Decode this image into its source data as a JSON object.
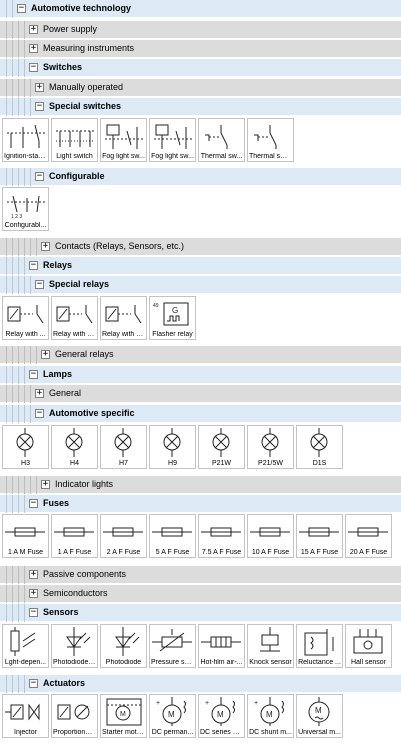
{
  "tree": {
    "automotive": {
      "label": "Automotive technology",
      "toggle": "−"
    },
    "power_supply": {
      "label": "Power supply",
      "toggle": "+"
    },
    "measuring": {
      "label": "Measuring instruments",
      "toggle": "+"
    },
    "switches": {
      "label": "Switches",
      "toggle": "−"
    },
    "manually_operated": {
      "label": "Manually operated",
      "toggle": "+"
    },
    "special_switches": {
      "label": "Special switches",
      "toggle": "−"
    },
    "configurable": {
      "label": "Configurable",
      "toggle": "−"
    },
    "contacts": {
      "label": "Contacts (Relays, Sensors, etc.)",
      "toggle": "+"
    },
    "relays": {
      "label": "Relays",
      "toggle": "−"
    },
    "special_relays": {
      "label": "Special relays",
      "toggle": "−"
    },
    "general_relays": {
      "label": "General relays",
      "toggle": "+"
    },
    "lamps": {
      "label": "Lamps",
      "toggle": "−"
    },
    "general": {
      "label": "General",
      "toggle": "+"
    },
    "automotive_specific": {
      "label": "Automotive specific",
      "toggle": "−"
    },
    "indicator_lights": {
      "label": "Indicator lights",
      "toggle": "+"
    },
    "fuses": {
      "label": "Fuses",
      "toggle": "−"
    },
    "passive": {
      "label": "Passive components",
      "toggle": "+"
    },
    "semiconductors": {
      "label": "Semiconductors",
      "toggle": "+"
    },
    "sensors": {
      "label": "Sensors",
      "toggle": "−"
    },
    "actuators": {
      "label": "Actuators",
      "toggle": "−"
    }
  },
  "tiles": {
    "special_switches": [
      {
        "caption": "Ignition-start...",
        "icon": "ignition-switch-icon"
      },
      {
        "caption": "Light switch",
        "icon": "light-switch-icon"
      },
      {
        "caption": "Fog light sw...",
        "icon": "fog-light-switch-icon"
      },
      {
        "caption": "Fog light sw...",
        "icon": "fog-light-switch-icon"
      },
      {
        "caption": "Thermal sw...",
        "icon": "thermal-switch-icon"
      },
      {
        "caption": "Thermal swi...",
        "icon": "thermal-switch-icon"
      }
    ],
    "configurable": [
      {
        "caption": "Configurabl...",
        "icon": "configurable-switch-icon"
      }
    ],
    "special_relays": [
      {
        "caption": "Relay with ...",
        "icon": "relay-icon"
      },
      {
        "caption": "Relay with b...",
        "icon": "relay-icon"
      },
      {
        "caption": "Relay with c...",
        "icon": "relay-icon"
      },
      {
        "caption": "Flasher relay",
        "icon": "flasher-relay-icon"
      }
    ],
    "automotive_specific": [
      {
        "caption": "H3",
        "icon": "lamp-icon"
      },
      {
        "caption": "H4",
        "icon": "lamp-icon"
      },
      {
        "caption": "H7",
        "icon": "lamp-icon"
      },
      {
        "caption": "H9",
        "icon": "lamp-icon"
      },
      {
        "caption": "P21W",
        "icon": "lamp-icon"
      },
      {
        "caption": "P21/5W",
        "icon": "lamp-icon"
      },
      {
        "caption": "D1S",
        "icon": "lamp-icon"
      }
    ],
    "fuses": [
      {
        "caption": "1 A M Fuse",
        "icon": "fuse-icon"
      },
      {
        "caption": "1 A F Fuse",
        "icon": "fuse-icon"
      },
      {
        "caption": "2 A F Fuse",
        "icon": "fuse-icon"
      },
      {
        "caption": "5 A F Fuse",
        "icon": "fuse-icon"
      },
      {
        "caption": "7.5 A F Fuse",
        "icon": "fuse-icon"
      },
      {
        "caption": "10 A F Fuse",
        "icon": "fuse-icon"
      },
      {
        "caption": "15 A F Fuse",
        "icon": "fuse-icon"
      },
      {
        "caption": "20 A F Fuse",
        "icon": "fuse-icon"
      }
    ],
    "sensors": [
      {
        "caption": "Lght-depen...",
        "icon": "light-dependent-resistor-icon"
      },
      {
        "caption": "Photodiode ...",
        "icon": "photodiode-icon"
      },
      {
        "caption": "Photodiode",
        "icon": "photodiode-icon"
      },
      {
        "caption": "Pressure se...",
        "icon": "pressure-sensor-icon"
      },
      {
        "caption": "Hot-film air-...",
        "icon": "hot-film-sensor-icon"
      },
      {
        "caption": "Knock sensor",
        "icon": "knock-sensor-icon"
      },
      {
        "caption": "Reluctance ...",
        "icon": "reluctance-sensor-icon"
      },
      {
        "caption": "Hall sensor",
        "icon": "hall-sensor-icon"
      }
    ],
    "actuators": [
      {
        "caption": "Injector",
        "icon": "injector-icon"
      },
      {
        "caption": "Proportional...",
        "icon": "proportional-valve-icon"
      },
      {
        "caption": "Starter moto...",
        "icon": "starter-motor-icon"
      },
      {
        "caption": "DC perman...",
        "icon": "dc-motor-icon"
      },
      {
        "caption": "DC series m...",
        "icon": "dc-motor-icon"
      },
      {
        "caption": "DC shunt m...",
        "icon": "dc-motor-icon"
      },
      {
        "caption": "Universal m...",
        "icon": "universal-motor-icon"
      }
    ]
  },
  "colors": {
    "expanded_row": "#dde9f5",
    "collapsed_row": "#dcdcdc",
    "tile_border": "#c4c4c4"
  }
}
